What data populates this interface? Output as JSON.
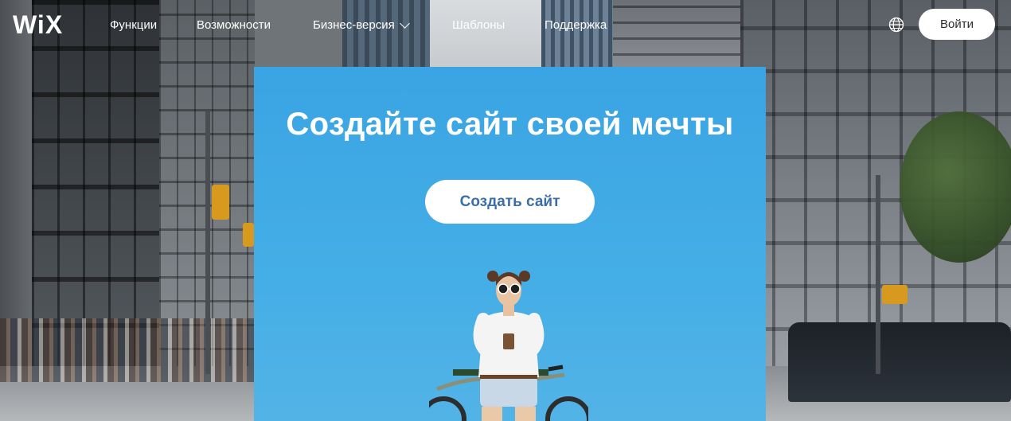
{
  "nav": {
    "logo": "WiX",
    "links": [
      {
        "label": "Функции"
      },
      {
        "label": "Возможности"
      },
      {
        "label": "Бизнес-версия"
      },
      {
        "label": "Шаблоны"
      },
      {
        "label": "Поддержка"
      }
    ],
    "login_label": "Войти"
  },
  "hero": {
    "title": "Создайте сайт своей мечты",
    "cta_label": "Создать сайт",
    "background_color": "#3aa4e4",
    "cta_text_color": "#3d6da8"
  },
  "icons": {
    "dropdown": "chevron-down-icon",
    "language": "globe-icon"
  }
}
